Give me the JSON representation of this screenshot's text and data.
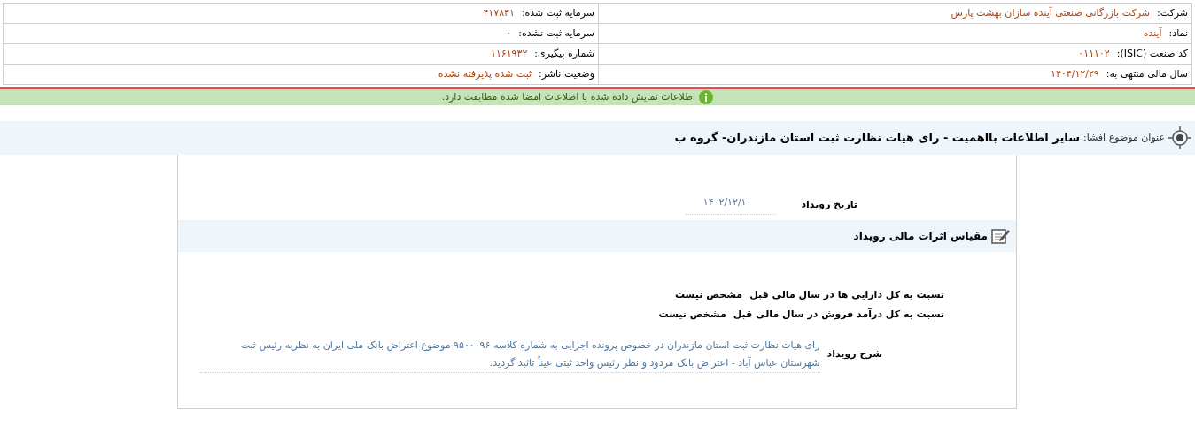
{
  "company_info": {
    "rows": [
      {
        "right": {
          "label": "شرکت:",
          "value": "شرکت بازرگانی صنعتی آینده سازان بهشت پارس"
        },
        "left": {
          "label": "سرمایه ثبت شده:",
          "value": "۴۱۷۸۳۱"
        }
      },
      {
        "right": {
          "label": "نماد:",
          "value": "آینده"
        },
        "left": {
          "label": "سرمایه ثبت نشده:",
          "value": "۰"
        }
      },
      {
        "right": {
          "label": "کد صنعت (ISIC):",
          "value": "۰۱۱۱۰۲"
        },
        "left": {
          "label": "شماره پیگیری:",
          "value": "۱۱۶۱۹۳۲"
        }
      },
      {
        "right": {
          "label": "سال مالی منتهی به:",
          "value": "۱۴۰۴/۱۲/۲۹"
        },
        "left": {
          "label": "وضعیت ناشر:",
          "value": "ثبت شده پذیرفته نشده"
        }
      }
    ]
  },
  "notice": {
    "text": "اطلاعات نمایش داده شده با اطلاعات امضا شده مطابقت دارد."
  },
  "disclosure": {
    "label": "عنوان موضوع افشا:",
    "title": "سایر اطلاعات بااهمیت - رای هیات نظارت ثبت استان مازندران- گروه ب"
  },
  "event_date": {
    "label": "تاریخ رویداد",
    "value": "۱۴۰۲/۱۲/۱۰"
  },
  "section": {
    "title": "مقیاس اثرات مالی رویداد"
  },
  "ratios": [
    {
      "label": "نسبت به کل دارایی ها در سال مالی قبل",
      "value": "مشخص نیست"
    },
    {
      "label": "نسبت به کل درآمد فروش در سال مالی قبل",
      "value": "مشخص نیست"
    }
  ],
  "description": {
    "label": "شرح رویداد",
    "text": "رای هیات نظارت ثبت استان مازندران در خصوص پرونده اجرایی به شماره کلاسه ۹۵۰۰۰۹۶ موضوع اعتراض بانک ملی ایران به نظریه رئیس ثبت شهرستان عباس آباد - اعتراض بانک مردود و نظر رئیس واحد ثبتی عیناً تائید گردید."
  }
}
